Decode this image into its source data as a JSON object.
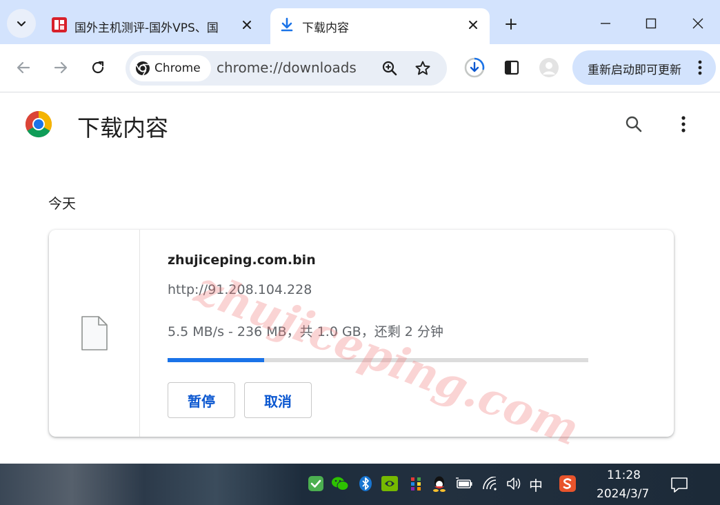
{
  "tabs": [
    {
      "title": "国外主机测评-国外VPS、国",
      "favicon": "site-favicon-icon",
      "active": false
    },
    {
      "title": "下载内容",
      "favicon": "download-icon",
      "active": true
    }
  ],
  "omnibox": {
    "chip_label": "Chrome",
    "url": "chrome://downloads"
  },
  "toolbar": {
    "update_label": "重新启动即可更新"
  },
  "page": {
    "title": "下载内容",
    "section": "今天"
  },
  "download": {
    "file_name": "zhujiceping.com.bin",
    "source_url": "http://91.208.104.228",
    "status": "5.5 MB/s - 236 MB，共 1.0 GB，还剩 2 分钟",
    "progress_fraction": 0.23,
    "pause_label": "暂停",
    "cancel_label": "取消"
  },
  "watermark": "zhujiceping.com",
  "taskbar": {
    "ime": "中",
    "time": "11:28",
    "date": "2024/3/7"
  },
  "colors": {
    "accent": "#1a73e8",
    "tabstrip": "#d3e3fd",
    "button_text": "#0b57d0"
  }
}
